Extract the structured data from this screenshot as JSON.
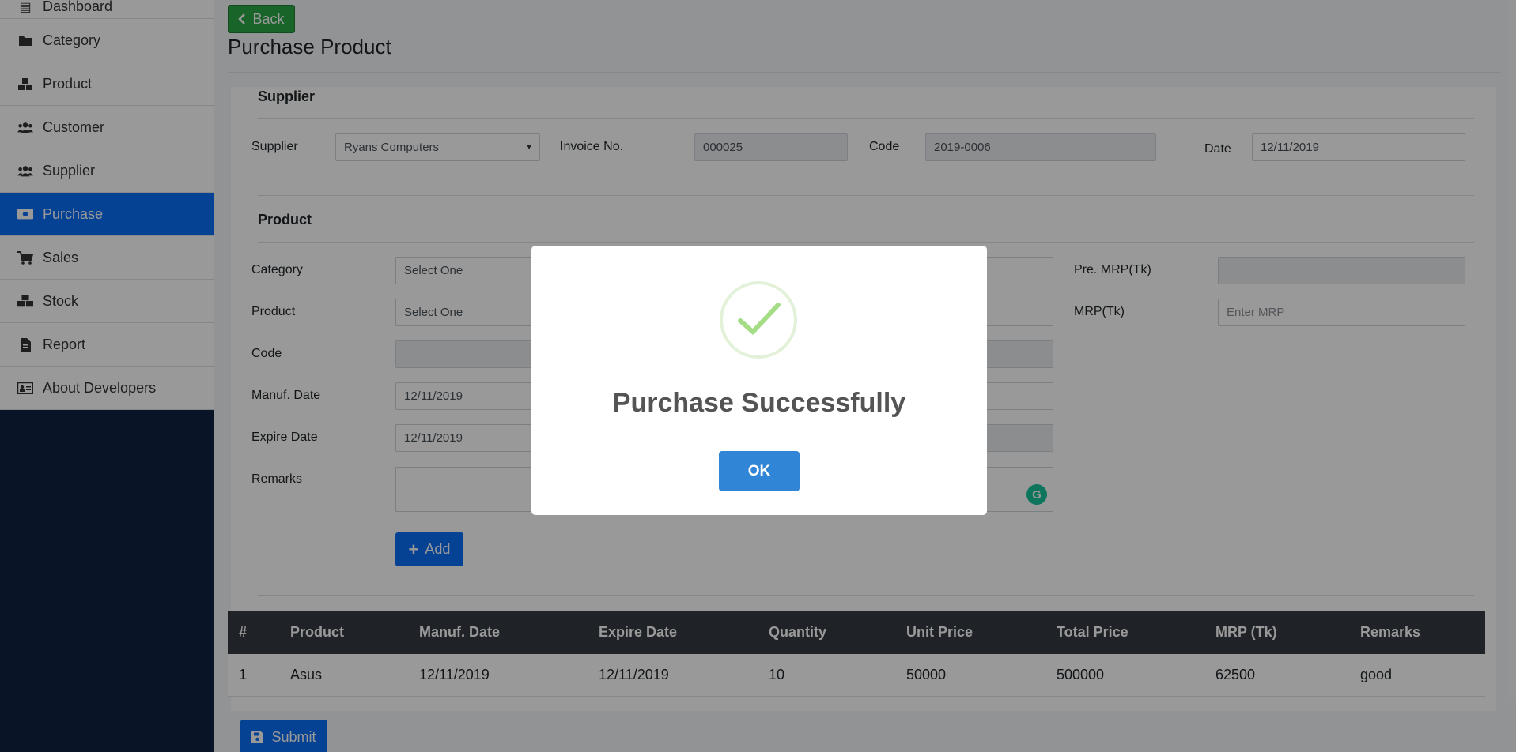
{
  "sidebar": {
    "items": [
      {
        "label": "Dashboard",
        "icon": "dashboard-icon"
      },
      {
        "label": "Category",
        "icon": "folder-icon"
      },
      {
        "label": "Product",
        "icon": "boxes-icon"
      },
      {
        "label": "Customer",
        "icon": "users-icon"
      },
      {
        "label": "Supplier",
        "icon": "users-icon"
      },
      {
        "label": "Purchase",
        "icon": "money-icon"
      },
      {
        "label": "Sales",
        "icon": "cart-icon"
      },
      {
        "label": "Stock",
        "icon": "cubes-icon"
      },
      {
        "label": "Report",
        "icon": "file-icon"
      },
      {
        "label": "About Developers",
        "icon": "id-card-icon"
      }
    ],
    "active": "Purchase"
  },
  "header": {
    "back_label": "Back",
    "title": "Purchase Product"
  },
  "supplier_section": {
    "title": "Supplier",
    "supplier_label": "Supplier",
    "supplier_value": "Ryans Computers",
    "invoice_label": "Invoice No.",
    "invoice_value": "000025",
    "code_label": "Code",
    "code_value": "2019-0006",
    "date_label": "Date",
    "date_value": "12/11/2019"
  },
  "product_section": {
    "title": "Product",
    "category_label": "Category",
    "category_value": "Select One",
    "product_label": "Product",
    "product_value": "Select One",
    "code_label": "Code",
    "manuf_label": "Manuf. Date",
    "manuf_value": "12/11/2019",
    "expire_label": "Expire Date",
    "expire_value": "12/11/2019",
    "remarks_label": "Remarks",
    "pre_mrp_label": "Pre. MRP(Tk)",
    "mrp_label": "MRP(Tk)",
    "mrp_placeholder": "Enter MRP",
    "add_label": "Add"
  },
  "table": {
    "headers": [
      "#",
      "Product",
      "Manuf. Date",
      "Expire Date",
      "Quantity",
      "Unit Price",
      "Total Price",
      "MRP (Tk)",
      "Remarks"
    ],
    "rows": [
      [
        "1",
        "Asus",
        "12/11/2019",
        "12/11/2019",
        "10",
        "50000",
        "500000",
        "62500",
        "good"
      ]
    ]
  },
  "submit_label": "Submit",
  "modal": {
    "title": "Purchase Successfully",
    "ok_label": "OK"
  },
  "colors": {
    "primary": "#0b6ff5",
    "success": "#28a745",
    "sidebar_dark": "#0f2341",
    "table_header": "#343a40",
    "modal_button": "#3085d6",
    "check": "#a5dc86"
  }
}
